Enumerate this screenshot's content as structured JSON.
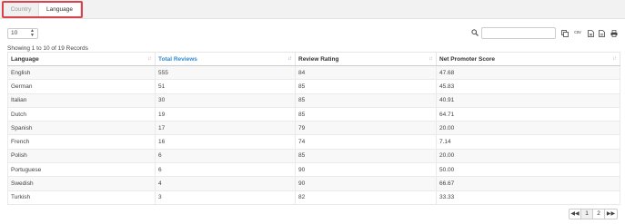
{
  "tabs": [
    {
      "label": "Country",
      "active": false
    },
    {
      "label": "Language",
      "active": true
    }
  ],
  "length_select": {
    "value": "10"
  },
  "search": {
    "value": ""
  },
  "toolbar": {
    "csv_label": "csv"
  },
  "info_text": "Showing 1 to 10 of 19 Records",
  "table": {
    "headers": [
      "Language",
      "Total Reviews",
      "Review Rating",
      "Net Promoter Score"
    ],
    "sorted_column": 1,
    "rows": [
      [
        "English",
        "555",
        "84",
        "47.68"
      ],
      [
        "German",
        "51",
        "85",
        "45.83"
      ],
      [
        "Italian",
        "30",
        "85",
        "40.91"
      ],
      [
        "Dutch",
        "19",
        "85",
        "64.71"
      ],
      [
        "Spanish",
        "17",
        "79",
        "20.00"
      ],
      [
        "French",
        "16",
        "74",
        "7.14"
      ],
      [
        "Polish",
        "6",
        "85",
        "20.00"
      ],
      [
        "Portuguese",
        "6",
        "90",
        "50.00"
      ],
      [
        "Swedish",
        "4",
        "90",
        "66.67"
      ],
      [
        "Turkish",
        "3",
        "82",
        "33.33"
      ]
    ]
  },
  "pagination": {
    "prev_icon": "double-chevron-left-icon",
    "pages": [
      "1",
      "2"
    ],
    "current": "1",
    "next_icon": "double-chevron-right-icon"
  }
}
